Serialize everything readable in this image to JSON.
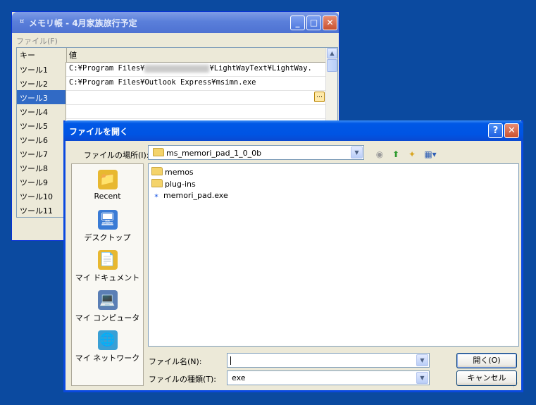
{
  "background_window": {
    "title": "メモリ帳 - 4月家族旅行予定",
    "title_icon": "¤",
    "menu_file": "ファイル(F)",
    "columns": {
      "key": "キー",
      "value": "値"
    },
    "rows": [
      {
        "key": "ツール1",
        "value_pre": "C:¥Program Files¥",
        "value_post": "¥LightWayText¥LightWay."
      },
      {
        "key": "ツール2",
        "value": "C:¥Program Files¥Outlook Express¥msimn.exe"
      },
      {
        "key": "ツール3",
        "value": "",
        "selected": true
      },
      {
        "key": "ツール4",
        "value": ""
      },
      {
        "key": "ツール5",
        "value": ""
      },
      {
        "key": "ツール6",
        "value": ""
      },
      {
        "key": "ツール7",
        "value": ""
      },
      {
        "key": "ツール8",
        "value": ""
      },
      {
        "key": "ツール9",
        "value": ""
      },
      {
        "key": "ツール10",
        "value": ""
      },
      {
        "key": "ツール11",
        "value": ""
      }
    ],
    "minimize_glyph": "_",
    "maximize_glyph": "□",
    "close_glyph": "✕",
    "ellipsis_glyph": "…",
    "scroll_up_glyph": "▲"
  },
  "dialog": {
    "title": "ファイルを開く",
    "help_glyph": "?",
    "close_glyph": "✕",
    "look_in_label": "ファイルの場所(I):",
    "look_in_value": "ms_memori_pad_1_0_0b",
    "dropdown_glyph": "▼",
    "toolbar": {
      "back": "◉",
      "up": "⬆",
      "new_folder": "✦",
      "views": "▦▾"
    },
    "places": [
      {
        "label": "Recent",
        "icon": "📁",
        "color": "#e8b830"
      },
      {
        "label": "デスクトップ",
        "icon": "🖥",
        "color": "#3a7bd5"
      },
      {
        "label": "マイ ドキュメント",
        "icon": "📄",
        "color": "#e8b830"
      },
      {
        "label": "マイ コンピュータ",
        "icon": "💻",
        "color": "#5b7fb5"
      },
      {
        "label": "マイ ネットワーク",
        "icon": "🌐",
        "color": "#3aa0d5"
      }
    ],
    "files": [
      {
        "name": "memos",
        "type": "folder"
      },
      {
        "name": "plug-ins",
        "type": "folder"
      },
      {
        "name": "memori_pad.exe",
        "type": "exe"
      }
    ],
    "exe_glyph": "✶",
    "filename_label": "ファイル名(N):",
    "filename_value": "",
    "filetype_label": "ファイルの種類(T):",
    "filetype_value": "exe",
    "open_button": "開く(O)",
    "cancel_button": "キャンセル",
    "grip_glyph": "⋰"
  }
}
